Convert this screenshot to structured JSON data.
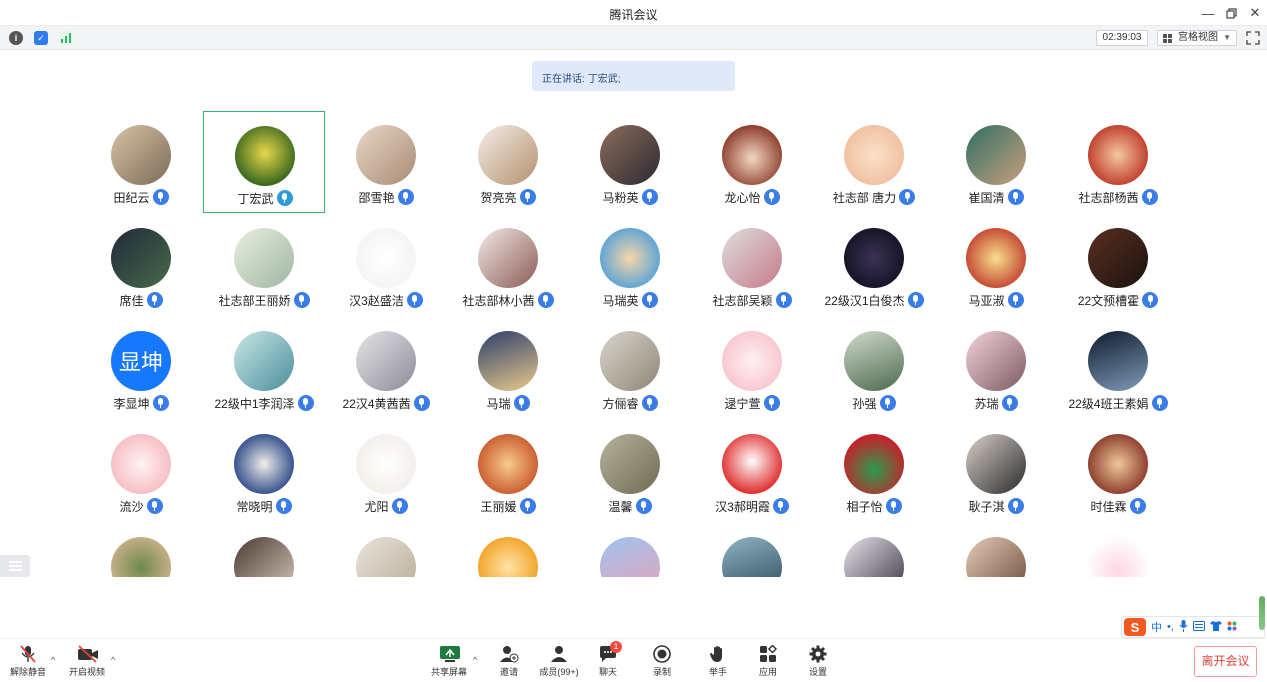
{
  "window": {
    "title": "腾讯会议"
  },
  "infobar": {
    "timer": "02:39:03",
    "view_mode": "宫格视图"
  },
  "speaker": {
    "prefix": "正在讲话:",
    "name": "丁宏武;"
  },
  "colors": {
    "accent": "#3b7de8",
    "active_border": "#2fb866",
    "leave": "#e0453a"
  },
  "participants": [
    {
      "name": "田纪云",
      "active": false,
      "bg": "linear-gradient(135deg,#d8c3a4,#7b6a58)"
    },
    {
      "name": "丁宏武",
      "active": true,
      "bg": "radial-gradient(circle at 50% 45%,#e8d84a,#3f6b1f 70%)"
    },
    {
      "name": "邵雪艳",
      "active": false,
      "bg": "linear-gradient(135deg,#e8d7c6,#a98b74)"
    },
    {
      "name": "贺亮亮",
      "active": false,
      "bg": "linear-gradient(135deg,#f2eee6,#b59070)"
    },
    {
      "name": "马粉英",
      "active": false,
      "bg": "linear-gradient(135deg,#8d6b5a,#2b2b33)"
    },
    {
      "name": "龙心怡",
      "active": false,
      "bg": "radial-gradient(circle at 50% 55%,#f4d7c4,#8a3b2a 75%)"
    },
    {
      "name": "社志部 唐力",
      "active": false,
      "bg": "radial-gradient(circle at 50% 50%,#fbe1c9,#f0c2a2 70%)"
    },
    {
      "name": "崔国清",
      "active": false,
      "bg": "linear-gradient(135deg,#2e6f63,#c9a07d)"
    },
    {
      "name": "社志部杨茜",
      "active": false,
      "bg": "radial-gradient(circle at 50% 50%,#f2c9a0,#c03a2b 75%)"
    },
    {
      "name": "席佳",
      "active": false,
      "bg": "linear-gradient(135deg,#1e2a38,#4a6a4a)"
    },
    {
      "name": "社志部王丽娇",
      "active": false,
      "bg": "linear-gradient(135deg,#e9efe0,#9fb6a2)"
    },
    {
      "name": "汉3赵盛洁",
      "active": false,
      "bg": "radial-gradient(circle at 50% 50%,#ffffff,#f5f5f5 70%)"
    },
    {
      "name": "社志部林小茜",
      "active": false,
      "bg": "linear-gradient(135deg,#f3e8e6,#8b5b55)"
    },
    {
      "name": "马瑞英",
      "active": false,
      "bg": "radial-gradient(circle at 50% 50%,#f7d6a8,#5aa3d6 75%)"
    },
    {
      "name": "社志部吴颖",
      "active": false,
      "bg": "linear-gradient(135deg,#dedede,#c57a8a)"
    },
    {
      "name": "22级汉1白俊杰",
      "active": false,
      "bg": "radial-gradient(circle at 50% 50%,#3c3354,#141326 75%)"
    },
    {
      "name": "马亚淑",
      "active": false,
      "bg": "radial-gradient(circle at 50% 50%,#f6e08c,#c0392b 80%)"
    },
    {
      "name": "22文预槽霍",
      "active": false,
      "bg": "linear-gradient(135deg,#5a2f21,#1a120e)"
    },
    {
      "name": "李显坤",
      "active": false,
      "bg": "#1677ff",
      "text": "显坤"
    },
    {
      "name": "22级中1李润泽",
      "active": false,
      "bg": "linear-gradient(135deg,#c8e6e6,#4b8f9c)"
    },
    {
      "name": "22汉4黄茜茜",
      "active": false,
      "bg": "linear-gradient(135deg,#e7e4e8,#8c8a97)"
    },
    {
      "name": "马瑞",
      "active": false,
      "bg": "linear-gradient(160deg,#2c3f6a,#e9c98d)"
    },
    {
      "name": "方俪睿",
      "active": false,
      "bg": "linear-gradient(135deg,#d9d4cb,#8f8778)"
    },
    {
      "name": "逯宁萱",
      "active": false,
      "bg": "radial-gradient(circle at 50% 50%,#fff0f2,#f7c6cf 75%)"
    },
    {
      "name": "孙强",
      "active": false,
      "bg": "linear-gradient(160deg,#cfdacb,#4e6a50)"
    },
    {
      "name": "苏瑞",
      "active": false,
      "bg": "linear-gradient(135deg,#f2d3d8,#7e5a63)"
    },
    {
      "name": "22级4班王素娟",
      "active": false,
      "bg": "linear-gradient(160deg,#0e1b2e,#7f9bb8)"
    },
    {
      "name": "流沙",
      "active": false,
      "bg": "radial-gradient(circle at 50% 50%,#fff3f3,#f6bcc2 75%)"
    },
    {
      "name": "常晓明",
      "active": false,
      "bg": "radial-gradient(circle at 50% 50%,#f1efe9,#2d4a8a 75%)"
    },
    {
      "name": "尤阳",
      "active": false,
      "bg": "radial-gradient(circle at 50% 50%,#ffffff,#f3efe9 75%)"
    },
    {
      "name": "王丽媛",
      "active": false,
      "bg": "radial-gradient(circle at 50% 50%,#f6cc8e,#c95a2c 75%)"
    },
    {
      "name": "温馨",
      "active": false,
      "bg": "linear-gradient(135deg,#b7b29e,#6f6a52)"
    },
    {
      "name": "汉3郝明霞",
      "active": false,
      "bg": "radial-gradient(circle at 50% 45%,#ffffff,#e03535 70%)"
    },
    {
      "name": "相子怡",
      "active": false,
      "bg": "radial-gradient(circle at 50% 60%,#2b9c4e,#c0262c 70%)"
    },
    {
      "name": "耿子淇",
      "active": false,
      "bg": "linear-gradient(135deg,#d8cfc9,#2a2a2a)"
    },
    {
      "name": "时佳霖",
      "active": false,
      "bg": "radial-gradient(circle at 50% 50%,#f0c79a,#8a3a2a 75%)"
    },
    {
      "name": "",
      "active": false,
      "bg": "radial-gradient(circle at 50% 50%,#6e8a4a,#c9b08a 75%)"
    },
    {
      "name": "",
      "active": false,
      "bg": "linear-gradient(135deg,#4a3a33,#d8c9bc)"
    },
    {
      "name": "",
      "active": false,
      "bg": "linear-gradient(135deg,#e8e4dc,#b9ab96)"
    },
    {
      "name": "",
      "active": false,
      "bg": "radial-gradient(circle at 50% 50%,#ffe3a8,#f2a325 75%)"
    },
    {
      "name": "",
      "active": false,
      "bg": "linear-gradient(160deg,#9ec3f0,#e8a2b7)"
    },
    {
      "name": "",
      "active": false,
      "bg": "linear-gradient(160deg,#8fb3c7,#2b4a55)"
    },
    {
      "name": "",
      "active": false,
      "bg": "linear-gradient(135deg,#e9e3ee,#3a3440)"
    },
    {
      "name": "",
      "active": false,
      "bg": "linear-gradient(135deg,#e6ccb8,#6a4a3a)"
    },
    {
      "name": "",
      "active": false,
      "bg": "radial-gradient(circle at 50% 55%,#ffd6e3,#ffffff 75%)"
    }
  ],
  "toolbar": {
    "unmute": "解除静音",
    "start_video": "开启视频",
    "share_screen": "共享屏幕",
    "invite": "邀请",
    "members": "成员(99+)",
    "chat": "聊天",
    "chat_badge": "1",
    "record": "录制",
    "raise_hand": "举手",
    "apps": "应用",
    "settings": "设置",
    "leave": "离开会议"
  },
  "ime": {
    "logo": "S",
    "mode": "中",
    "punct": "•,",
    "icons": [
      "mic-icon",
      "keyboard-icon",
      "shirt-icon",
      "grid-icon"
    ]
  }
}
